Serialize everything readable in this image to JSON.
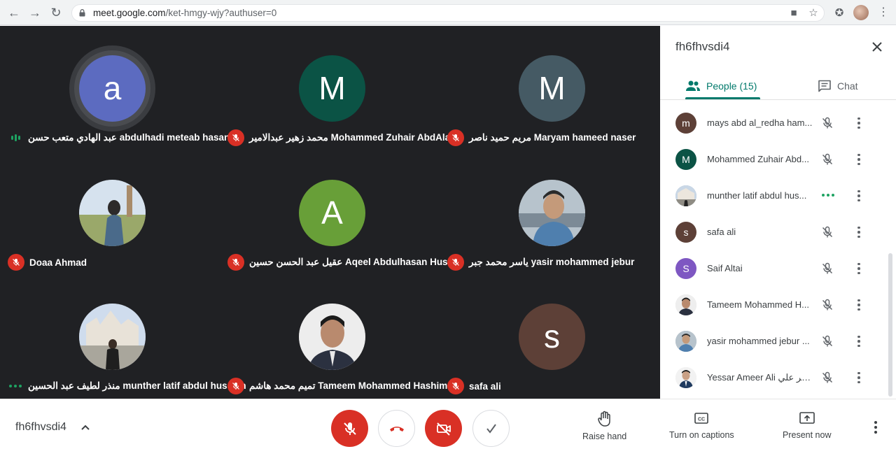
{
  "browser": {
    "url_host": "meet.google.com",
    "url_path": "/ket-hmgy-wjy?authuser=0"
  },
  "tiles": [
    {
      "name": "عبد الهادي متعب حسن abdulhadi meteab hasan",
      "avatar_letter": "a",
      "avatar_color": "#5c6bc0",
      "status": "speaking",
      "speaking": true
    },
    {
      "name": "محمد زهير عبدالامير Mohammed Zuhair AbdAla...",
      "avatar_letter": "M",
      "avatar_color": "#0b5345",
      "status": "muted"
    },
    {
      "name": "مريم حميد ناصر Maryam hameed naser",
      "avatar_letter": "M",
      "avatar_color": "#455a64",
      "status": "muted"
    },
    {
      "name": "Doaa Ahmad",
      "avatar_letter": "",
      "avatar_color": "#8a9b7a",
      "status": "muted",
      "photo": "landscape"
    },
    {
      "name": "عقيل عبد الحسن حسين Aqeel Abdulhasan Husein",
      "avatar_letter": "A",
      "avatar_color": "#689f38",
      "status": "muted"
    },
    {
      "name": "ياسر محمد جبر yasir mohammed jebur",
      "avatar_letter": "",
      "avatar_color": "#9aa7b4",
      "status": "muted",
      "photo": "portrait"
    },
    {
      "name": "منذر لطيف عبد الحسين munther latif abdul hussein",
      "avatar_letter": "",
      "avatar_color": "#b0c4de",
      "status": "dots",
      "photo": "building"
    },
    {
      "name": "تميم محمد هاشم Tameem Mohammed Hashim",
      "avatar_letter": "",
      "avatar_color": "#e8e8e8",
      "status": "muted",
      "photo": "man"
    },
    {
      "name": "safa ali",
      "avatar_letter": "s",
      "avatar_color": "#5d4037",
      "status": "muted"
    }
  ],
  "panel": {
    "title": "fh6fhvsdi4",
    "tab_people": "People (15)",
    "tab_chat": "Chat",
    "people": [
      {
        "name": "mays abd al_redha ham...",
        "letter": "m",
        "color": "#5d4037",
        "status": "muted"
      },
      {
        "name": "Mohammed Zuhair Abd...",
        "letter": "M",
        "color": "#0b5345",
        "status": "muted"
      },
      {
        "name": "munther latif abdul hus...",
        "letter": "",
        "color": "#9fb3c8",
        "status": "dots"
      },
      {
        "name": "safa ali",
        "letter": "s",
        "color": "#5d4037",
        "status": "muted"
      },
      {
        "name": "Saif Altai",
        "letter": "S",
        "color": "#7e57c2",
        "status": "muted"
      },
      {
        "name": "Tameem Mohammed H...",
        "letter": "",
        "color": "#d7d7d7",
        "status": "muted"
      },
      {
        "name": "yasir mohammed jebur ...",
        "letter": "",
        "color": "#9aa7b4",
        "status": "muted"
      },
      {
        "name": "Yessar Ameer Ali امير علي...",
        "letter": "",
        "color": "#e4e4e4",
        "status": "muted"
      }
    ]
  },
  "bottom": {
    "meeting_code": "fh6fhvsdi4",
    "raise_hand": "Raise hand",
    "captions": "Turn on captions",
    "present": "Present now"
  },
  "colors": {
    "accent": "#00796b",
    "danger": "#d93025",
    "grid_bg": "#202124"
  }
}
